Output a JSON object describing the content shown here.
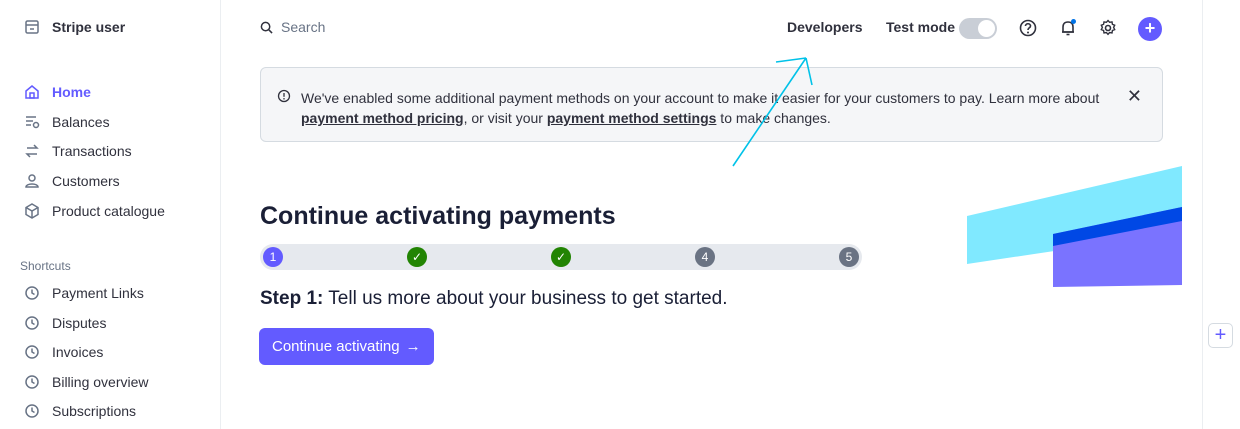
{
  "account": {
    "name": "Stripe user"
  },
  "nav": [
    {
      "label": "Home",
      "icon": "home-icon",
      "active": true
    },
    {
      "label": "Balances",
      "icon": "balances-icon"
    },
    {
      "label": "Transactions",
      "icon": "transactions-icon"
    },
    {
      "label": "Customers",
      "icon": "customers-icon"
    },
    {
      "label": "Product catalogue",
      "icon": "product-catalogue-icon"
    }
  ],
  "shortcuts": {
    "title": "Shortcuts",
    "items": [
      {
        "label": "Payment Links",
        "icon": "clock-icon"
      },
      {
        "label": "Disputes",
        "icon": "clock-icon"
      },
      {
        "label": "Invoices",
        "icon": "clock-icon"
      },
      {
        "label": "Billing overview",
        "icon": "clock-icon"
      },
      {
        "label": "Subscriptions",
        "icon": "clock-icon"
      }
    ]
  },
  "topbar": {
    "search_placeholder": "Search",
    "developers": "Developers",
    "test_mode": "Test mode",
    "test_mode_on": false
  },
  "banner": {
    "text_1": "We've enabled some additional payment methods on your account to make it easier for your customers to pay. Learn more about ",
    "link_1": "payment method pricing",
    "text_2": ", or visit your ",
    "link_2": "payment method settings",
    "text_3": " to make changes.",
    "close": "✕"
  },
  "main": {
    "heading": "Continue activating payments",
    "steps": [
      {
        "label": "1",
        "state": "current"
      },
      {
        "label": "✓",
        "state": "done"
      },
      {
        "label": "✓",
        "state": "done"
      },
      {
        "label": "4",
        "state": "todo"
      },
      {
        "label": "5",
        "state": "todo"
      }
    ],
    "step_prefix": "Step 1:",
    "step_text": " Tell us more about your business to get started.",
    "cta_label": "Continue activating",
    "cta_arrow": "→"
  },
  "right_panel": {
    "plus": "+"
  },
  "colors": {
    "accent": "#635bff",
    "success": "#228403",
    "cyan_deco": "#80e9ff",
    "annotation": "#00c2e8"
  }
}
